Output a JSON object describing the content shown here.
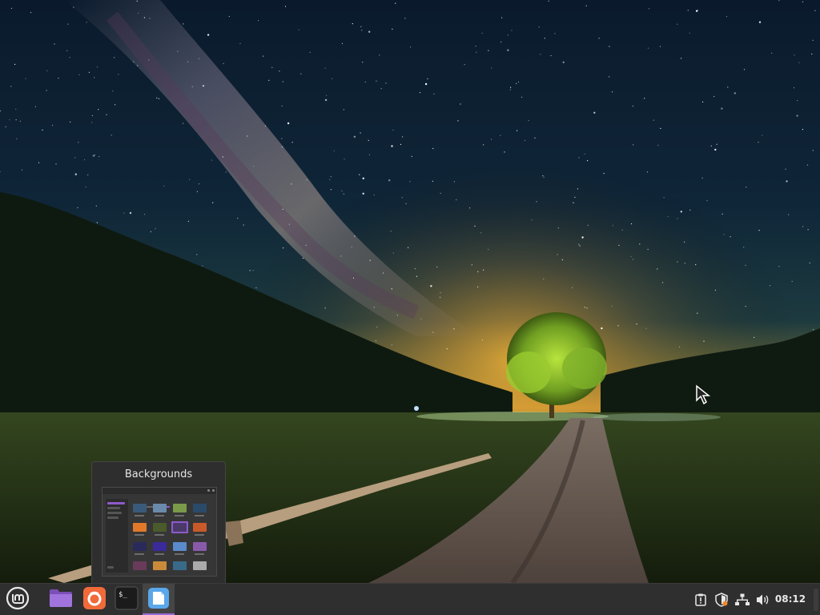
{
  "desktop": {
    "wallpaper": "night-sky-milky-way-tree-field"
  },
  "window_preview": {
    "title": "Backgrounds"
  },
  "taskbar": {
    "menu_icon": "linux-mint-logo-icon",
    "launchers": [
      {
        "name": "Files",
        "icon": "folder-icon",
        "color": "#9b6bd8"
      },
      {
        "name": "Firefox",
        "icon": "firefox-icon",
        "color": "#f2683a"
      },
      {
        "name": "Terminal",
        "icon": "terminal-icon",
        "color": "#1e1e1e"
      },
      {
        "name": "Backgrounds",
        "icon": "backgrounds-app-icon",
        "color": "#5aa7ea",
        "active": true
      }
    ],
    "tray": [
      "update-manager-icon",
      "security-shield-icon",
      "network-icon",
      "volume-icon"
    ],
    "clock": "08:12"
  },
  "colors": {
    "panel": "#2f2f30",
    "accent": "#9a6ad6"
  }
}
